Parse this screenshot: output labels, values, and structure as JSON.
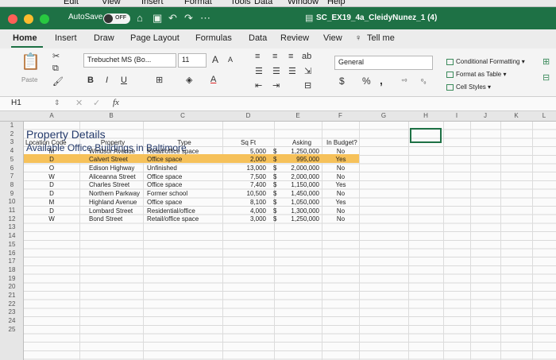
{
  "app": {
    "mac_menu": [
      "Edit",
      "View",
      "Insert",
      "Format",
      "Tools",
      "Data",
      "Window",
      "Help"
    ],
    "autosave_label": "AutoSave",
    "autosave_state": "OFF",
    "doc_title": "SC_EX19_4a_CleidyNunez_1 (4)",
    "accent": "#1e7145"
  },
  "ribbon_tabs": [
    "Home",
    "Insert",
    "Draw",
    "Page Layout",
    "Formulas",
    "Data",
    "Review",
    "View"
  ],
  "tell_me": "Tell me",
  "ribbon": {
    "paste_label": "Paste",
    "font_name": "Trebuchet MS (Bo...",
    "font_size": "11",
    "grow_font": "A",
    "shrink_font": "A",
    "bold": "B",
    "italic": "I",
    "underline": "U",
    "font_color_letter": "A",
    "number_format": "General",
    "currency": "$",
    "percent": "%",
    "comma": ",",
    "conditional_formatting": "Conditional Formatting",
    "format_as_table": "Format as Table",
    "cell_styles": "Cell Styles"
  },
  "formula_bar": {
    "name_box": "H1",
    "fx": "fx"
  },
  "columns": [
    "A",
    "B",
    "C",
    "D",
    "E",
    "F",
    "G",
    "H",
    "I",
    "J",
    "K",
    "L"
  ],
  "rows": [
    "1",
    "2",
    "3",
    "4",
    "5",
    "6",
    "7",
    "8",
    "9",
    "10",
    "11",
    "12",
    "13",
    "14",
    "15",
    "16",
    "17",
    "18",
    "19",
    "20",
    "21",
    "22",
    "23",
    "24",
    "25"
  ],
  "sheet": {
    "title": "Property Details",
    "subtitle": "Available Office Buildings in Baltimore",
    "headers": [
      "Location Code",
      "Property",
      "Type",
      "Sq Ft",
      "Asking",
      "In Budget?"
    ],
    "data": [
      [
        "M",
        "Windsor Avenue",
        "Retail/office space",
        "5,000",
        "$",
        "1,250,000",
        "No"
      ],
      [
        "D",
        "Calvert Street",
        "Office space",
        "2,000",
        "$",
        "995,000",
        "Yes"
      ],
      [
        "O",
        "Edison Highway",
        "Unfinished",
        "13,000",
        "$",
        "2,000,000",
        "No"
      ],
      [
        "W",
        "Aliceanna Street",
        "Office space",
        "7,500",
        "$",
        "2,000,000",
        "No"
      ],
      [
        "D",
        "Charles Street",
        "Office space",
        "7,400",
        "$",
        "1,150,000",
        "Yes"
      ],
      [
        "D",
        "Northern Parkway",
        "Former school",
        "10,500",
        "$",
        "1,450,000",
        "No"
      ],
      [
        "M",
        "Highland Avenue",
        "Office space",
        "8,100",
        "$",
        "1,050,000",
        "Yes"
      ],
      [
        "D",
        "Lombard Street",
        "Residential/office",
        "4,000",
        "$",
        "1,300,000",
        "No"
      ],
      [
        "W",
        "Bond Street",
        "Retail/office space",
        "3,000",
        "$",
        "1,250,000",
        "No"
      ]
    ]
  },
  "selected_cell": "H1"
}
